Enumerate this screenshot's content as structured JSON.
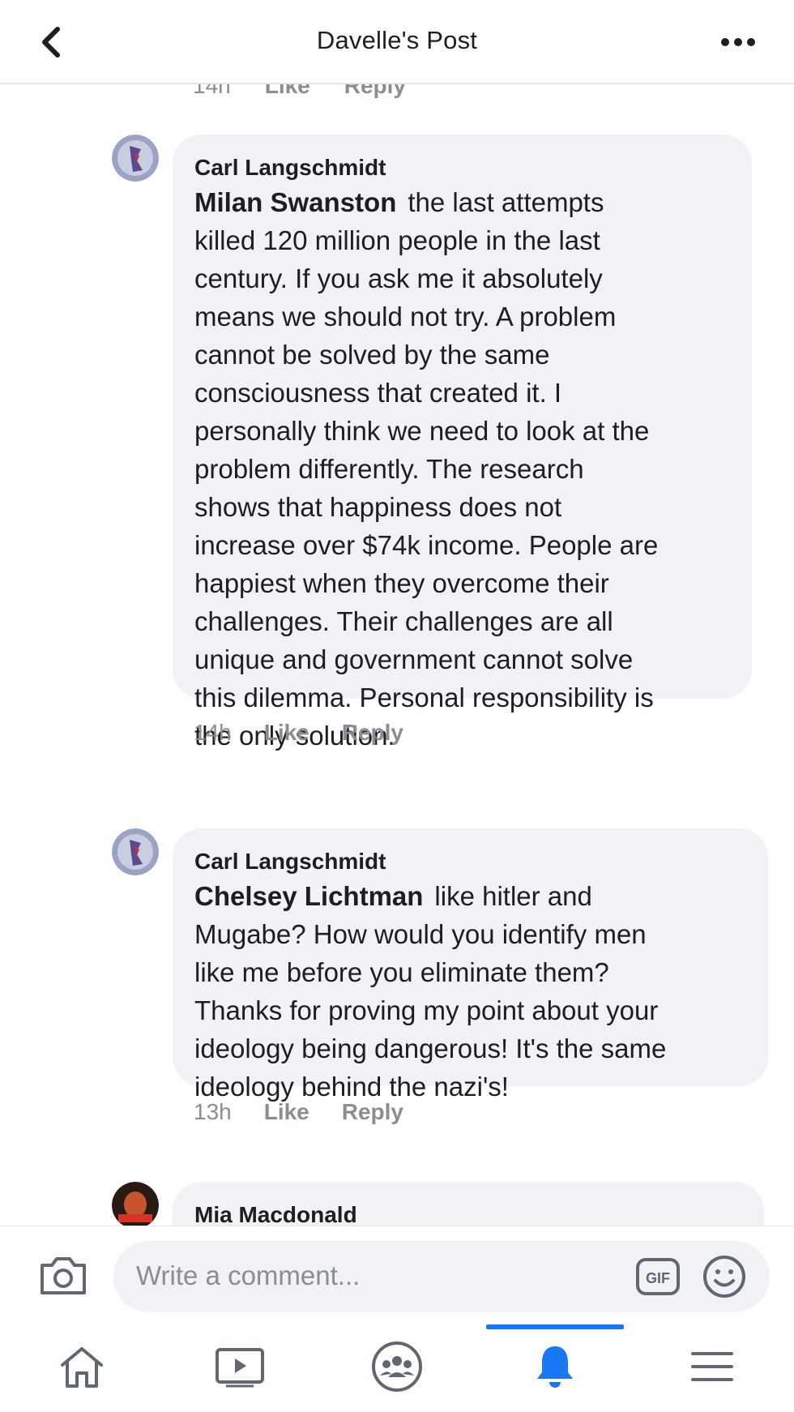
{
  "header": {
    "title": "Davelle's Post"
  },
  "partial_comment_meta": {
    "time": "14h",
    "like": "Like",
    "reply": "Reply"
  },
  "comments": [
    {
      "author": "Carl Langschmidt",
      "mention": "Milan Swanston",
      "lines": [
        "the last attempts",
        "killed 120 million people in the last",
        "century. If you ask me it absolutely",
        "means we should not try. A problem",
        "cannot be solved by the same",
        "consciousness that created it. I",
        "personally think we need to look at the",
        "problem differently. The research",
        "shows that happiness does not",
        "increase over $74k income. People are",
        "happiest when they overcome their",
        "challenges. Their challenges are all",
        "unique and government cannot solve",
        "this dilemma. Personal responsibility is",
        "the only solution."
      ],
      "time": "14h",
      "like": "Like",
      "reply": "Reply"
    },
    {
      "author": "Carl Langschmidt",
      "mention": "Chelsey Lichtman",
      "lines": [
        "like hitler and",
        "Mugabe? How would you identify men",
        "like me before you eliminate them?",
        "Thanks for proving my point about your",
        "ideology being dangerous! It's the same",
        "ideology behind the nazi's!"
      ],
      "time": "13h",
      "like": "Like",
      "reply": "Reply"
    },
    {
      "author": "Mia Macdonald"
    }
  ],
  "composer": {
    "placeholder": "Write a comment..."
  },
  "nav": {
    "active_tab": "notifications",
    "active_color": "#1877f2"
  }
}
